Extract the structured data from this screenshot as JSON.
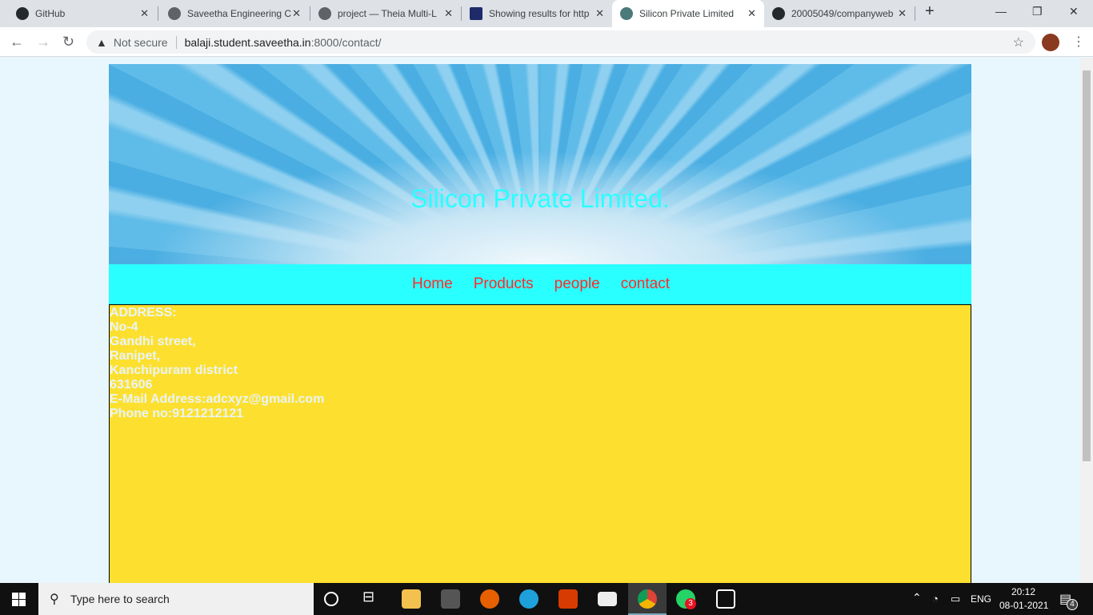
{
  "browser": {
    "tabs": [
      {
        "label": "GitHub",
        "icon": "github-icon"
      },
      {
        "label": "Saveetha Engineering C",
        "icon": "globe-icon"
      },
      {
        "label": "project — Theia Multi-L",
        "icon": "globe-icon"
      },
      {
        "label": "Showing results for http",
        "icon": "validator-icon"
      },
      {
        "label": "Silicon Private Limited",
        "icon": "gear-icon",
        "active": true
      },
      {
        "label": "20005049/companyweb",
        "icon": "github-icon"
      }
    ],
    "security": "Not secure",
    "url_host": "balaji.student.saveetha.in",
    "url_path": ":8000/contact/"
  },
  "site": {
    "title": "Silicon Private Limited.",
    "nav": [
      "Home",
      "Products",
      "people",
      "contact"
    ],
    "address_lines": [
      "ADDRESS:",
      "No-4",
      "Gandhi street,",
      "Ranipet,",
      "Kanchipuram district",
      "631606",
      "E-Mail Address:adcxyz@gmail.com",
      "Phone no:9121212121"
    ],
    "colors": {
      "title": "#2affff",
      "nav_bg": "#2affff",
      "nav_link": "#ff2a2a",
      "content_bg": "#fde02f",
      "content_text": "#e8f4f8"
    }
  },
  "taskbar": {
    "search_placeholder": "Type here to search",
    "lang": "ENG",
    "time": "20:12",
    "date": "08-01-2021",
    "whatsapp_badge": "3",
    "notifications": "4"
  }
}
